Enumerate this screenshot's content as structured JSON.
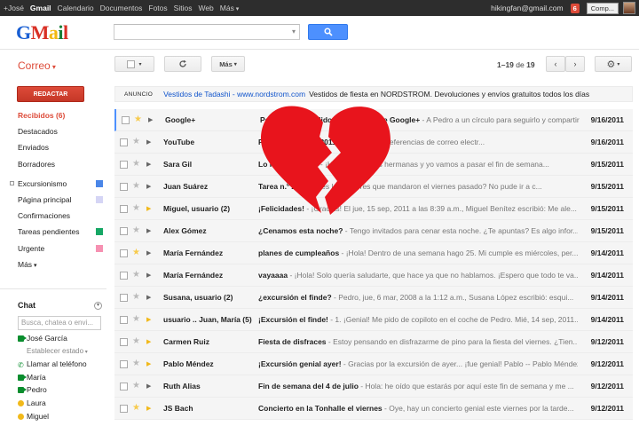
{
  "topbar": {
    "nav": [
      "+José",
      "Gmail",
      "Calendario",
      "Documentos",
      "Fotos",
      "Sitios",
      "Web",
      "Más"
    ],
    "email": "hikingfan@gmail.com",
    "notifications": "6",
    "share_label": "Comp..."
  },
  "logo": {
    "g1": "G",
    "g2": "M",
    "g3": "a",
    "g4": "i",
    "g5": "l"
  },
  "header": {
    "search_placeholder": "",
    "correo_label": "Correo",
    "more_label": "Más",
    "pager": {
      "range": "1–19",
      "of": "de",
      "total": "19"
    }
  },
  "sidebar": {
    "compose_label": "REDACTAR",
    "items": [
      {
        "label": "Recibidos (6)",
        "active": true
      },
      {
        "label": "Destacados"
      },
      {
        "label": "Enviados"
      },
      {
        "label": "Borradores"
      }
    ],
    "labels": [
      {
        "label": "Excursionismo",
        "color": "#4a86e8"
      },
      {
        "label": "Página principal",
        "color": "#d5d5f5"
      },
      {
        "label": "Confirmaciones",
        "color": ""
      },
      {
        "label": "Tareas pendientes",
        "color": "#16a765"
      },
      {
        "label": "Urgente",
        "color": "#f691b2"
      },
      {
        "label": "Más",
        "color": ""
      }
    ]
  },
  "chat": {
    "title": "Chat",
    "search_placeholder": "Busca, chatea o envi...",
    "contacts": [
      {
        "name": "José García",
        "status": "video"
      },
      {
        "name": "Establecer estado",
        "status": "sub"
      },
      {
        "name": "Llamar al teléfono",
        "status": "phone"
      },
      {
        "name": "María",
        "status": "video"
      },
      {
        "name": "Pedro",
        "status": "video"
      },
      {
        "name": "Laura",
        "status": "away"
      },
      {
        "name": "Miguel",
        "status": "away"
      }
    ]
  },
  "ad": {
    "label": "ANUNCIO",
    "link": "Vestidos de Tadashi - www.nordstrom.com",
    "text": "Vestidos de fiesta en NORDSTROM. Devoluciones y envíos gratuitos todos los días"
  },
  "emails": [
    {
      "from": "Google+",
      "subject": "Pedro te ha añadido a un círculo de Google+",
      "snippet": " - A Pedro a un círculo para seguirlo y compartir ...",
      "date": "9/16/2011",
      "star": true,
      "important": false
    },
    {
      "from": "YouTube",
      "subject": "Pedro, ... 16 sep, 2011",
      "snippet": " - Cambia las preferencias de correo electr...",
      "date": "9/16/2011",
      "star": false,
      "important": false
    },
    {
      "from": "Sara Gil",
      "subject": "Lo hemos hecho",
      "snippet": " - ¡Hola chicos! Mis hermanas y yo vamos a pasar el fin de semana...",
      "date": "9/15/2011",
      "star": false,
      "important": false
    },
    {
      "from": "Juan Suárez",
      "subject": "Tarea n.º 2",
      "snippet": " - ¿Tienes los deberes que mandaron el viernes pasado? No pude ir a c...",
      "date": "9/15/2011",
      "star": false,
      "important": false
    },
    {
      "from": "Miguel, usuario (2)",
      "subject": "¡Felicidades!",
      "snippet": " - ¡Gracias! El jue, 15 sep, 2011 a las 8:39 a.m., Miguel Benítez escribió: Me ale...",
      "date": "9/15/2011",
      "star": false,
      "important": true
    },
    {
      "from": "Alex Gómez",
      "subject": "¿Cenamos esta noche?",
      "snippet": " - Tengo invitados para cenar esta noche. ¿Te apuntas? Es algo infor...",
      "date": "9/15/2011",
      "star": false,
      "important": false
    },
    {
      "from": "María Fernández",
      "subject": "planes de cumpleaños",
      "snippet": " - ¡Hola! Dentro de una semana hago 25. Mi cumple es miércoles, per...",
      "date": "9/14/2011",
      "star": true,
      "important": false
    },
    {
      "from": "María Fernández",
      "subject": "vayaaaa",
      "snippet": " - ¡Hola! Solo quería saludarte, que hace ya que no hablamos. ¡Espero que todo te va...",
      "date": "9/14/2011",
      "star": false,
      "important": false
    },
    {
      "from": "Susana, usuario (2)",
      "subject": "¿excursión el finde?",
      "snippet": " - Pedro, jue, 6 mar, 2008 a la 1:12 a.m., Susana López escribió: esqui...",
      "date": "9/14/2011",
      "star": false,
      "important": false
    },
    {
      "from": "usuario .. Juan, María (5)",
      "subject": "¡Excursión el finde!",
      "snippet": " - 1. ¡Genial! Me pido de copiloto en el coche de Pedro. Mié, 14 sep, 2011...",
      "date": "9/14/2011",
      "star": false,
      "important": true
    },
    {
      "from": "Carmen Ruiz",
      "subject": "Fiesta de disfraces",
      "snippet": " - Estoy pensando en disfrazarme de pino para la fiesta del viernes. ¿Tien...",
      "date": "9/12/2011",
      "star": false,
      "important": true
    },
    {
      "from": "Pablo Méndez",
      "subject": "¡Excursión genial ayer!",
      "snippet": " - Gracias por la excursión de ayer... ¡fue genial! Pablo -- Pablo Méndez",
      "date": "9/12/2011",
      "star": false,
      "important": true
    },
    {
      "from": "Ruth Alias",
      "subject": "Fin de semana del 4 de julio",
      "snippet": " - Hola: he oído que estarás por aquí este fin de semana y me ...",
      "date": "9/12/2011",
      "star": false,
      "important": false
    },
    {
      "from": "JS Bach",
      "subject": "Concierto en la Tonhalle el viernes",
      "snippet": " - Oye, hay un concierto genial este viernes por la tarde...",
      "date": "9/12/2011",
      "star": true,
      "important": true
    }
  ],
  "colors": {
    "accent_red": "#dd4b39",
    "search_blue": "#4d90fe",
    "link_blue": "#1155cc",
    "heart_red": "#e8141c"
  }
}
